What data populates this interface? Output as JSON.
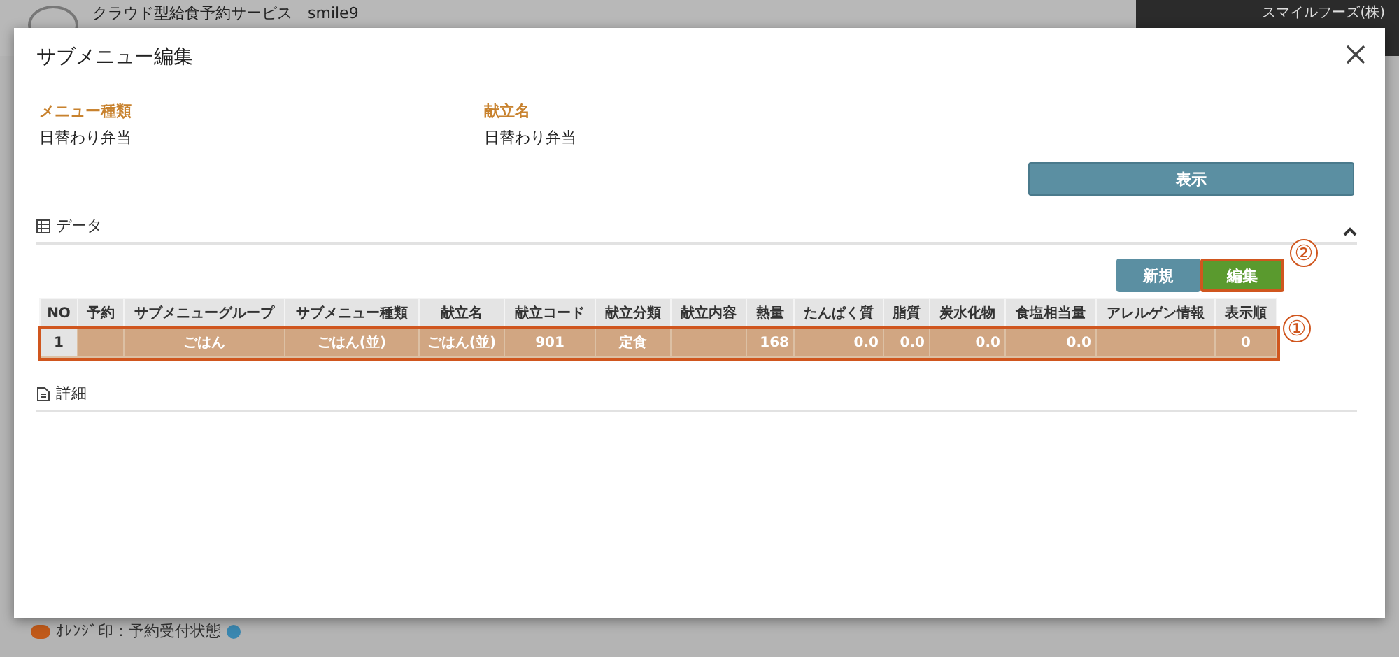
{
  "app_header": {
    "title": "クラウド型給食予約サービス　smile9",
    "user": "スマイルフーズ(株)"
  },
  "legend": {
    "text": "ｵﾚﾝｼﾞ印：予約受付状態"
  },
  "dialog": {
    "title": "サブメニュー編集",
    "fields": [
      {
        "label": "メニュー種類",
        "value": "日替わり弁当"
      },
      {
        "label": "献立名",
        "value": "日替わり弁当"
      }
    ],
    "show_button": "表示",
    "data_section": {
      "title": "データ",
      "expanded": true
    },
    "buttons": [
      {
        "label": "新規",
        "kind": "new"
      },
      {
        "label": "編集",
        "kind": "edit",
        "callout": "②"
      }
    ],
    "table": {
      "columns": [
        "NO",
        "予約",
        "サブメニューグループ",
        "サブメニュー種類",
        "献立名",
        "献立コード",
        "献立分類",
        "献立内容",
        "熱量",
        "たんぱく質",
        "脂質",
        "炭水化物",
        "食塩相当量",
        "アレルゲン情報",
        "表示順"
      ],
      "rows": [
        {
          "selected": true,
          "callout": "①",
          "cells": [
            "1",
            "",
            "ごはん",
            "ごはん(並)",
            "ごはん(並)",
            "901",
            "定食",
            "",
            "168",
            "0.0",
            "0.0",
            "0.0",
            "0.0",
            "",
            "0"
          ]
        }
      ]
    },
    "detail_section": {
      "title": "詳細"
    }
  }
}
